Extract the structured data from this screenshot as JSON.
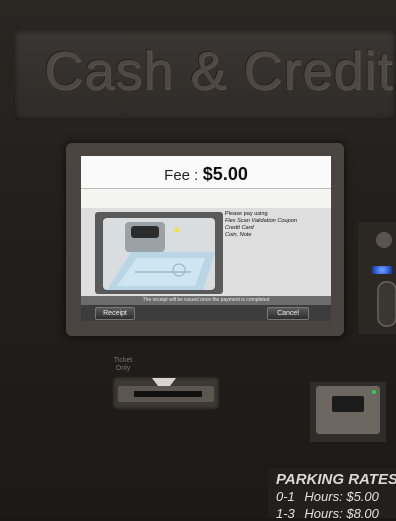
{
  "machine": {
    "brand_text": "Cash & Credit"
  },
  "screen": {
    "fee_label": "Fee :",
    "fee_amount": "$5.00",
    "instructions": [
      "Please pay using",
      "Flex Scan Validation Coupon",
      "Credit Card",
      "Coin, Note"
    ],
    "notice": "The receipt will be issued once the payment is completed",
    "receipt_button": "Receipt",
    "cancel_button": "Cancel"
  },
  "ticket_slot": {
    "label": "Ticket Only"
  },
  "parking_rates": {
    "title": "PARKING RATES",
    "rows": [
      {
        "range": "0-1",
        "label": "Hours:",
        "price": "$5.00"
      },
      {
        "range": "1-3",
        "label": "Hours:",
        "price": "$8.00"
      }
    ]
  },
  "colors": {
    "screen_background": "#f4f4f2",
    "led_blue": "#3d6cf0"
  }
}
